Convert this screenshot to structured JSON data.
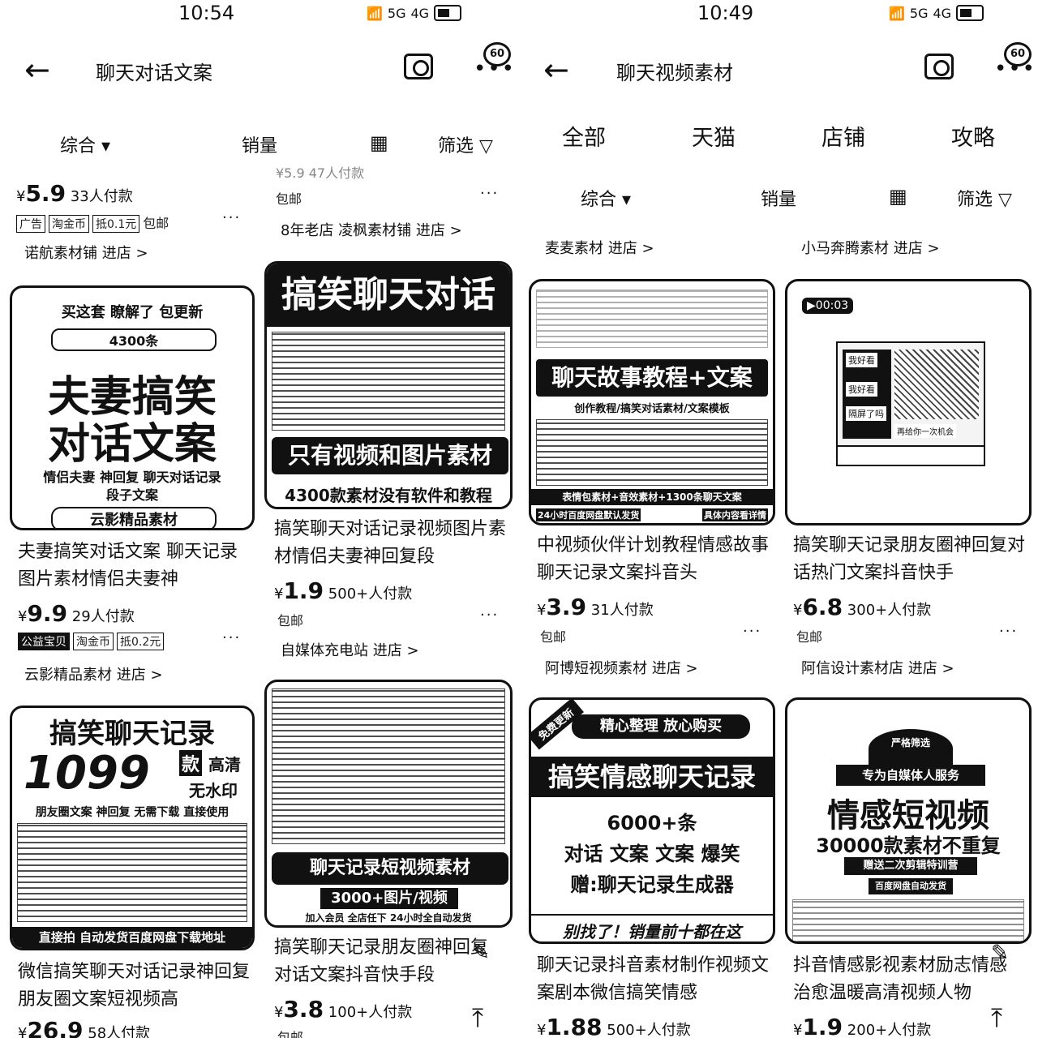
{
  "left": {
    "status": {
      "time": "10:54",
      "signal1": "5G",
      "signal2": "4G"
    },
    "header": {
      "title": "聊天对话文案",
      "badge": "60"
    },
    "filters": {
      "sort": "综合",
      "sales": "销量",
      "filter": "筛选"
    },
    "cut": {
      "price_prefix": "¥",
      "price": "5.9",
      "sold": "33人付款",
      "tags": [
        "广告",
        "淘金币",
        "抵0.1元",
        "包邮"
      ],
      "shop": "诺航素材铺 进店 >"
    },
    "cut2": {
      "price": "¥5.9 47人付款",
      "ship": "包邮",
      "shop": "8年老店 凌枫素材铺 进店 >"
    },
    "card1": {
      "img_lines": [
        "买这套 瞭解了 包更新",
        "4300条",
        "夫妻搞笑",
        "对话文案",
        "情侣夫妻 神回复 聊天对话记录",
        "段子文案",
        "云影精品素材"
      ],
      "desc": "夫妻搞笑对话文案 聊天记录图片素材情侣夫妻神",
      "price": "9.9",
      "sold": "29人付款",
      "tags": [
        "公益宝贝",
        "淘金币",
        "抵0.2元"
      ],
      "shop": "云影精品素材 进店 >"
    },
    "card2": {
      "img_lines": [
        "搞笑聊天对话",
        "只有视频和图片素材",
        "4300款素材没有软件和教程"
      ],
      "desc": "搞笑聊天对话记录视频图片素材情侣夫妻神回复段",
      "price": "1.9",
      "sold": "500+人付款",
      "ship": "包邮",
      "shop": "自媒体充电站 进店 >"
    },
    "card3": {
      "img_lines": [
        "搞笑聊天记录",
        "1099",
        "款",
        "高清",
        "无水印",
        "朋友圈文案 神回复 无需下载 直接使用",
        "直接拍 自动发货百度网盘下载地址"
      ],
      "desc": "微信搞笑聊天对话记录神回复朋友圈文案短视频高",
      "price": "26.9",
      "sold": "58人付款"
    },
    "card4": {
      "img_lines": [
        "聊天记录短视频素材",
        "3000+图片/视频",
        "加入会员 全店任下 24小时全自动发货"
      ],
      "desc": "搞笑聊天记录朋友圈神回复对话文案抖音快手段",
      "price": "3.8",
      "sold": "100+人付款",
      "ship": "包邮"
    }
  },
  "right": {
    "status": {
      "time": "10:49",
      "signal1": "5G",
      "signal2": "4G"
    },
    "header": {
      "title": "聊天视频素材",
      "badge": "60"
    },
    "tabs": [
      "全部",
      "天猫",
      "店铺",
      "攻略"
    ],
    "filters": {
      "sort": "综合",
      "sales": "销量",
      "filter": "筛选"
    },
    "shops_top": [
      "麦麦素材 进店 >",
      "小马奔腾素材 进店 >"
    ],
    "card1": {
      "img_lines": [
        "聊天故事教程+文案",
        "创作教程/搞笑对话素材/文案模板",
        "表情包素材+音效素材+1300条聊天文案",
        "24小时百度网盘默认发货",
        "具体内容看详情"
      ],
      "desc": "中视频伙伴计划教程情感故事聊天记录文案抖音头",
      "price": "3.9",
      "sold": "31人付款",
      "ship": "包邮",
      "shop": "阿博短视频素材 进店 >"
    },
    "card2": {
      "video_time": "00:03",
      "chat": [
        "我好看",
        "我好看",
        "隔屏了吗",
        "再给你一次机会"
      ],
      "desc": "搞笑聊天记录朋友圈神回复对话热门文案抖音快手",
      "price": "6.8",
      "sold": "300+人付款",
      "ship": "包邮",
      "shop": "阿信设计素材店 进店 >"
    },
    "card3": {
      "img_lines": [
        "免费更新",
        "精心整理 放心购买",
        "搞笑情感聊天记录",
        "6000+条",
        "对话 文案 文案 爆笑",
        "赠:聊天记录生成器",
        "别找了！销量前十都在这"
      ],
      "desc": "聊天记录抖音素材制作视频文案剧本微信搞笑情感",
      "price": "1.88",
      "sold": "500+人付款"
    },
    "card4": {
      "img_lines": [
        "严格筛选",
        "专为自媒体人服务",
        "情感短视频",
        "30000款素材不重复",
        "赠送二次剪辑特训营",
        "百度网盘自动发货"
      ],
      "desc": "抖音情感影视素材励志情感治愈温暖高清视频人物",
      "price": "1.9",
      "sold": "200+人付款"
    }
  }
}
